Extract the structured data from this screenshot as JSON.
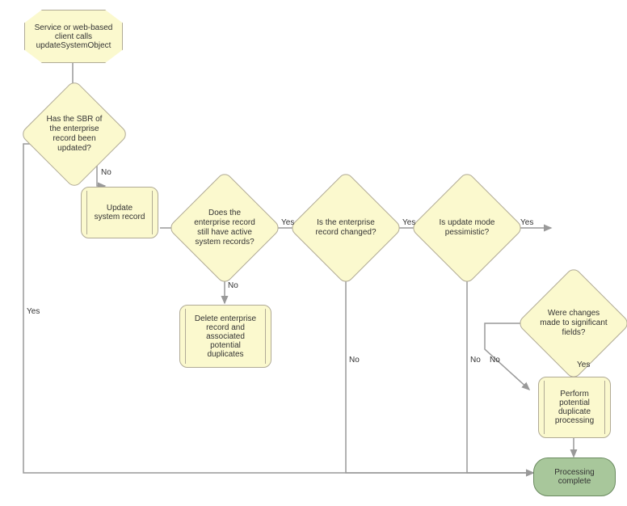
{
  "chart_data": {
    "type": "flowchart",
    "nodes": [
      {
        "id": "start",
        "type": "octagon",
        "text": "Service or web-based client calls updateSystemObject"
      },
      {
        "id": "d1",
        "type": "decision",
        "text": "Has the SBR of the enterprise record been updated?"
      },
      {
        "id": "p1",
        "type": "process",
        "text": "Update system record"
      },
      {
        "id": "d2",
        "type": "decision",
        "text": "Does the enterprise record still have active system records?"
      },
      {
        "id": "p2",
        "type": "process",
        "text": "Delete enterprise record and associated potential duplicates"
      },
      {
        "id": "d3",
        "type": "decision",
        "text": "Is the enterprise record changed?"
      },
      {
        "id": "d4",
        "type": "decision",
        "text": "Is update mode pessimistic?"
      },
      {
        "id": "d5",
        "type": "decision",
        "text": "Were changes made to significant fields?"
      },
      {
        "id": "p3",
        "type": "process",
        "text": "Perform potential duplicate processing"
      },
      {
        "id": "end",
        "type": "terminator",
        "text": "Processing complete"
      }
    ],
    "edges": [
      {
        "from": "start",
        "to": "d1"
      },
      {
        "from": "d1",
        "to": "p1",
        "label": "No"
      },
      {
        "from": "d1",
        "to": "end",
        "label": "Yes"
      },
      {
        "from": "p1",
        "to": "d2"
      },
      {
        "from": "d2",
        "to": "p2",
        "label": "No"
      },
      {
        "from": "d2",
        "to": "d3",
        "label": "Yes"
      },
      {
        "from": "d3",
        "to": "d4",
        "label": "Yes"
      },
      {
        "from": "d3",
        "to": "end",
        "label": "No"
      },
      {
        "from": "d4",
        "to": "d5",
        "label": "Yes"
      },
      {
        "from": "d4",
        "to": "end",
        "label": "No"
      },
      {
        "from": "d5",
        "to": "p3",
        "label": "Yes"
      },
      {
        "from": "d5",
        "to": "p3",
        "label": "No"
      },
      {
        "from": "p3",
        "to": "end"
      }
    ]
  },
  "labels": {
    "yes": "Yes",
    "no": "No"
  }
}
